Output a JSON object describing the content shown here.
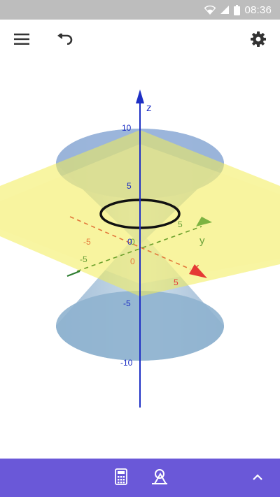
{
  "status_bar": {
    "time": "08:36",
    "icons": [
      "wifi-icon",
      "signal-icon",
      "battery-icon"
    ]
  },
  "toolbar": {
    "icons": [
      "menu-icon",
      "undo-icon",
      "settings-icon"
    ]
  },
  "graph3d": {
    "axes": {
      "x": {
        "label": "x",
        "ticks": [
          "-5",
          "0",
          "5"
        ],
        "color": "#e53935"
      },
      "y": {
        "label": "y",
        "ticks": [
          "-5",
          "0",
          "5"
        ],
        "color": "#689f38"
      },
      "z": {
        "label": "z",
        "ticks": [
          "10",
          "5",
          "0",
          "-5",
          "-10"
        ],
        "color": "#1e2fc4"
      }
    },
    "colors": {
      "cone": "#9fb9dc",
      "plane": "#f5f07a",
      "ellipse": "#111111"
    }
  },
  "bottom_bar": {
    "background": "#6a58d8",
    "icons": [
      "calculator-icon",
      "tools-icon",
      "chevron-up-icon"
    ]
  }
}
